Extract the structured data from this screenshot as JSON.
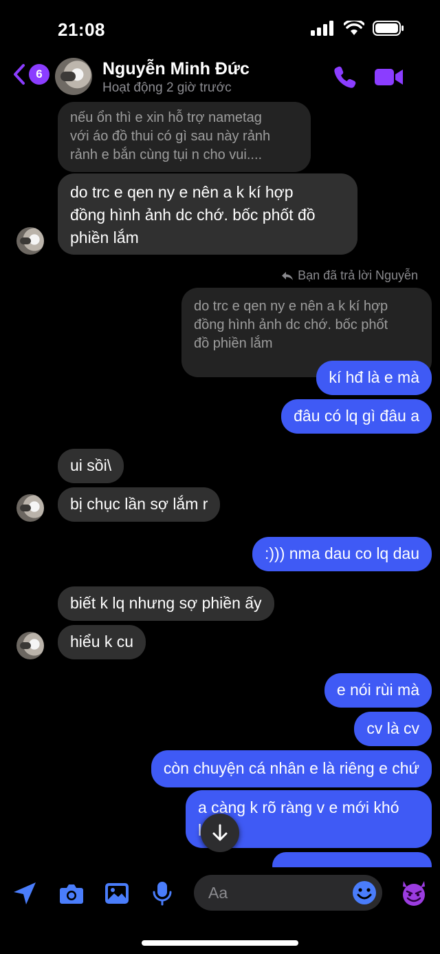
{
  "status_bar": {
    "time": "21:08"
  },
  "header": {
    "back_badge": "6",
    "contact_name": "Nguyễn Minh Đức",
    "contact_status": "Hoạt động 2 giờ trước"
  },
  "messages": [
    {
      "id": "m1",
      "side": "in",
      "quoted": true,
      "lines": [
        "nếu ổn thì e xin hỗ trợ nametag",
        "với áo đồ thui có gì sau này rảnh",
        "rảnh e bắn cùng tụi n cho vui...."
      ]
    },
    {
      "id": "m2",
      "side": "in",
      "lines": [
        "do trc e qen ny e nên a k kí hợp",
        "đồng hình ảnh dc chớ. bốc phốt đồ",
        "phiền lắm"
      ]
    },
    {
      "id": "m3",
      "side": "out",
      "quoted": true,
      "lines": [
        "do trc e qen ny e nên a k kí hợp",
        "đồng hình ảnh dc chớ. bốc phốt",
        "đồ phiền lắm"
      ]
    },
    {
      "id": "m4",
      "side": "out",
      "lines": [
        "kí hđ là e mà"
      ]
    },
    {
      "id": "m5",
      "side": "out",
      "lines": [
        "đâu có lq gì đâu a"
      ]
    },
    {
      "id": "m6",
      "side": "in",
      "lines": [
        "ui sồi\\"
      ]
    },
    {
      "id": "m7",
      "side": "in",
      "lines": [
        "bị chục lần sợ lắm r"
      ]
    },
    {
      "id": "m8",
      "side": "out",
      "lines": [
        ":))) nma dau co lq dau"
      ]
    },
    {
      "id": "m9",
      "side": "in",
      "lines": [
        "biết k lq nhưng sợ phiền ấy"
      ]
    },
    {
      "id": "m10",
      "side": "in",
      "lines": [
        "hiểu k cu"
      ]
    },
    {
      "id": "m11",
      "side": "out",
      "lines": [
        "e nói rùi mà"
      ]
    },
    {
      "id": "m12",
      "side": "out",
      "lines": [
        "cv là cv"
      ]
    },
    {
      "id": "m13",
      "side": "out",
      "lines": [
        "còn chuyện cá nhân e là riêng e chứ"
      ]
    },
    {
      "id": "m14",
      "side": "out",
      "lines": [
        "a càng k rõ ràng v e mới khó",
        "l    iệc"
      ]
    }
  ],
  "reply_note": "Bạn đã trả lời Nguyễn",
  "composer": {
    "placeholder": "Aa"
  },
  "colors": {
    "accent": "#8b3dff",
    "outgoing_bubble": "#3f5af5",
    "incoming_bubble": "#303030"
  },
  "icons": [
    "back-chevron-icon",
    "phone-icon",
    "video-camera-icon",
    "location-arrow-icon",
    "camera-icon",
    "image-icon",
    "microphone-icon",
    "emoji-icon",
    "devil-emoji-icon",
    "arrow-down-icon",
    "reply-arrow-icon"
  ]
}
